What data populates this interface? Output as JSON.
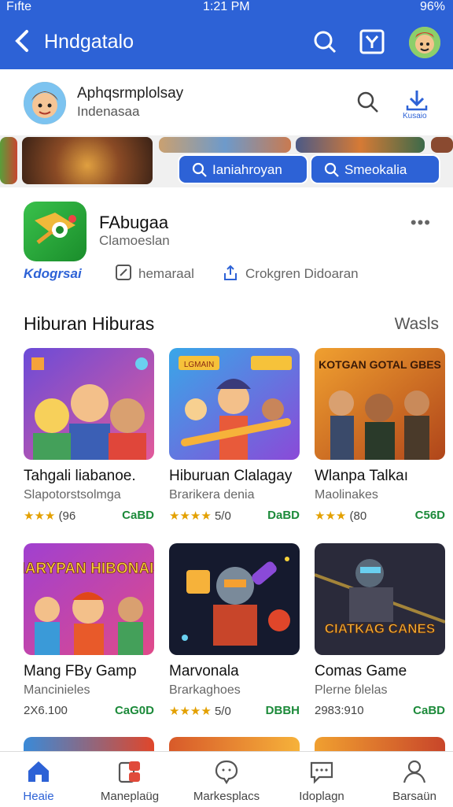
{
  "status": {
    "left": "Fıfte",
    "time": "1:21 PM",
    "battery": "96%"
  },
  "header": {
    "title": "Hndgatalo",
    "icons": [
      "back-icon",
      "search-icon",
      "filter-icon",
      "avatar"
    ]
  },
  "account": {
    "name": "Aphqsrmplolsay",
    "region": "Indenasaa",
    "download_label": "Kusaio"
  },
  "quick": {
    "pill1": "Ianiahroyan",
    "pill2": "Smeokalia"
  },
  "featured": {
    "title": "FAbugaa",
    "subtitle": "Clamoeslan",
    "category": "Kdogrsai",
    "action1": "hemaraal",
    "action2": "Crokgren Didoaran",
    "more": "•••"
  },
  "section": {
    "title": "Hiburan Hiburas",
    "more": "Wasls"
  },
  "apps": [
    {
      "name": "Tahgali liabanoe.",
      "dev": "Slapotorstsolmga",
      "stars": "★★★",
      "rating": "(96",
      "price": "CaBD"
    },
    {
      "name": "Hiburuan Clalagay",
      "dev": "Brarikera denia",
      "stars": "★★★★",
      "rating": "5/0",
      "price": "DaBD"
    },
    {
      "name": "Wlanpa Talkaı",
      "dev": "Maolinakes",
      "stars": "★★★",
      "rating": "(80",
      "price": "C56D"
    },
    {
      "name": "Mang FBy Gamp",
      "dev": "Mancinieles",
      "metric": "2X6.100",
      "price": "CaG0D"
    },
    {
      "name": "Marvonala",
      "dev": "Brarkaghoes",
      "stars": "★★★★",
      "rating": "5/0",
      "price": "DBBH"
    },
    {
      "name": "Comas Game",
      "dev": "Plerne ɓlelas",
      "metric": "2983:910",
      "price": "CaBD"
    }
  ],
  "art_text": {
    "a4": "NARYPAN HIBONAIS",
    "a6": "CIATKAG CANES",
    "a3": "KOTGAN GOTAL GBES",
    "a2": "LGMAIN"
  },
  "nav": [
    {
      "label": "Heaie",
      "icon": "home-icon"
    },
    {
      "label": "Maneplaüg",
      "icon": "apps-icon"
    },
    {
      "label": "Markesplacs",
      "icon": "chat-icon"
    },
    {
      "label": "Idoplagn",
      "icon": "message-icon"
    },
    {
      "label": "Barsaün",
      "icon": "profile-icon"
    }
  ],
  "colors": {
    "primary": "#2d62d6",
    "price": "#1c8a3a",
    "star": "#e3a000"
  }
}
